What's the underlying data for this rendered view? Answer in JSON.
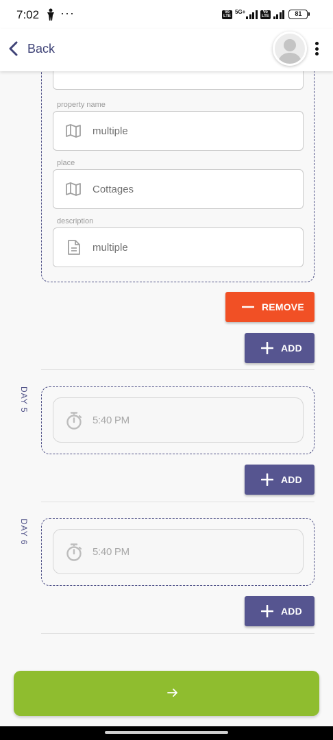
{
  "status_bar": {
    "time": "7:02",
    "dots": "···",
    "network": "5G+",
    "battery": "81"
  },
  "header": {
    "back_label": "Back"
  },
  "form": {
    "property_name_label": "property name",
    "property_name_value": "multiple",
    "place_label": "place",
    "place_value": "Cottages",
    "description_label": "description",
    "description_value": "multiple"
  },
  "buttons": {
    "remove_label": "REMOVE",
    "add_label": "ADD"
  },
  "days": [
    {
      "label": "DAY 5",
      "time": "5:40 PM"
    },
    {
      "label": "DAY 6",
      "time": "5:40 PM"
    }
  ],
  "colors": {
    "primary": "#565590",
    "remove": "#f15025",
    "next": "#8fbd2f"
  },
  "icons": {
    "field_property": "map-icon",
    "field_place": "map-icon",
    "field_description": "document-icon",
    "time": "stopwatch-icon",
    "next": "arrow-right-icon"
  }
}
